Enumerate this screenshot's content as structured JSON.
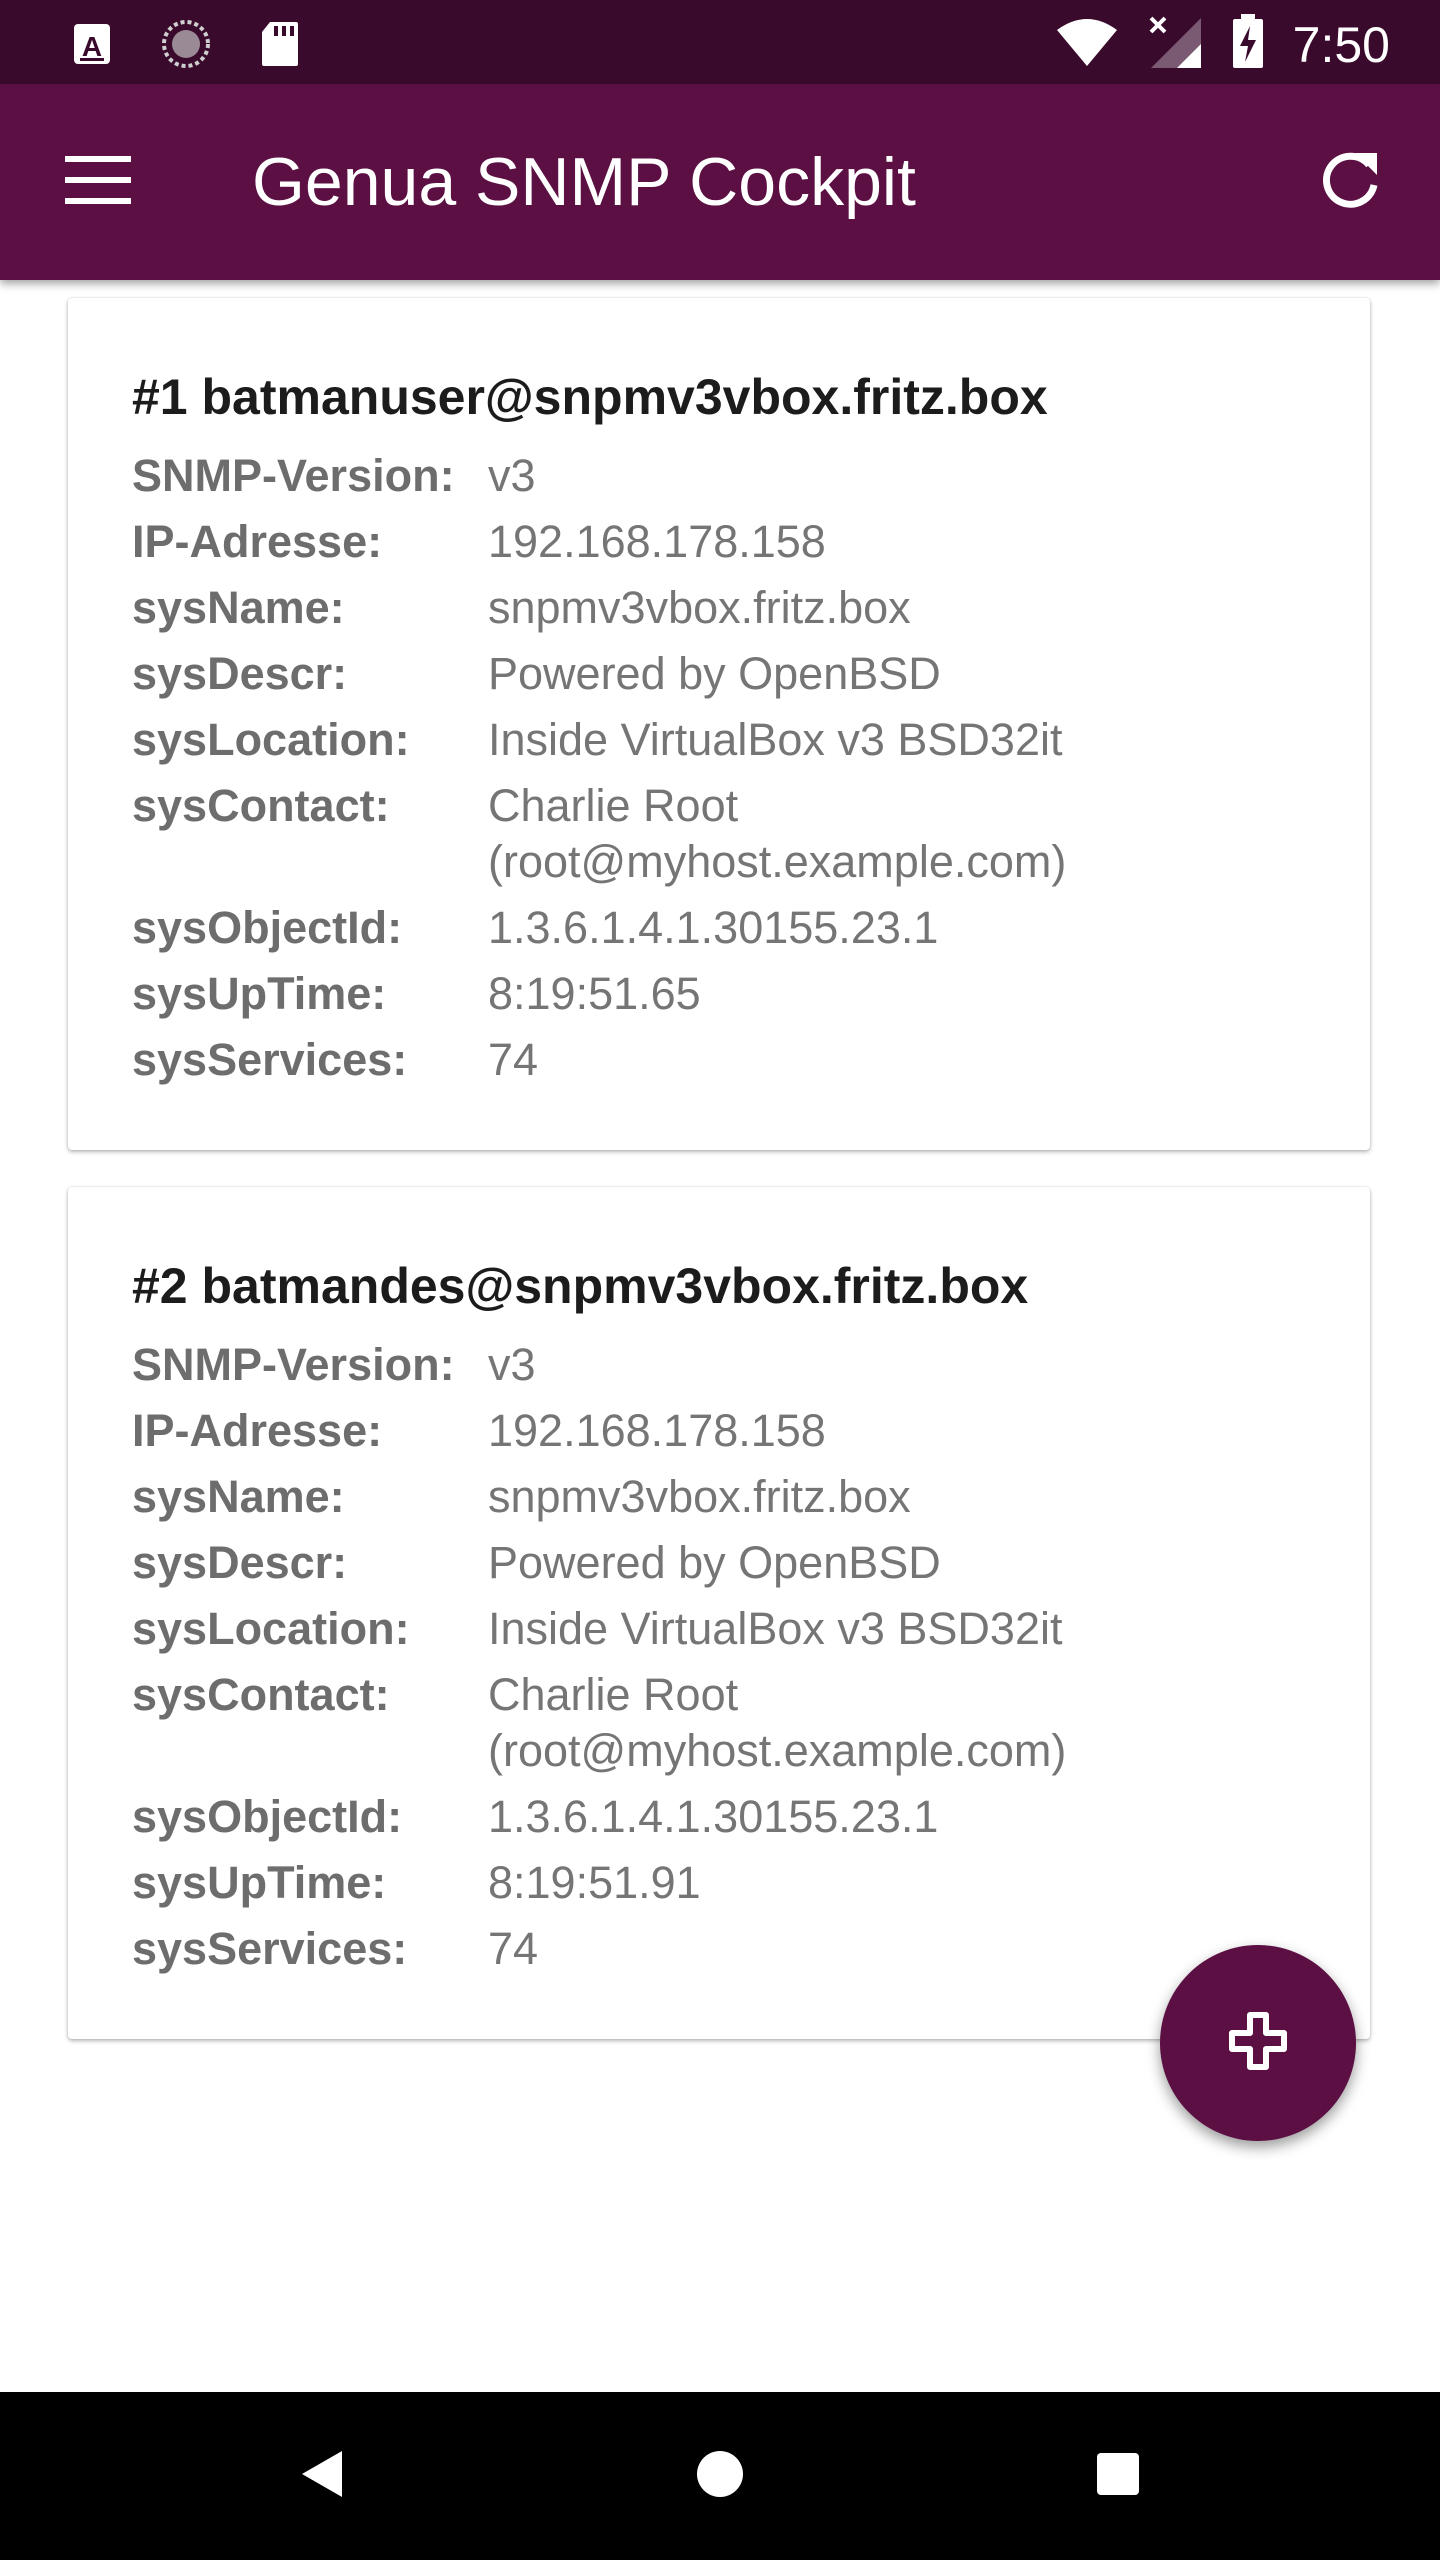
{
  "status_bar": {
    "time": "7:50",
    "icons_left": [
      "a-notification-icon",
      "sync-icon",
      "sd-card-icon"
    ],
    "icons_right": [
      "wifi-icon",
      "cellular-no-signal-icon",
      "battery-charging-icon"
    ]
  },
  "app_bar": {
    "title": "Genua SNMP Cockpit",
    "menu_icon": "hamburger-menu-icon",
    "refresh_icon": "refresh-icon",
    "color": "#5b0f43"
  },
  "devices": [
    {
      "title": "#1 batmanuser@snpmv3vbox.fritz.box",
      "rows": [
        {
          "label": "SNMP-Version:",
          "value": "v3"
        },
        {
          "label": "IP-Adresse:",
          "value": "192.168.178.158"
        },
        {
          "label": "sysName:",
          "value": "snpmv3vbox.fritz.box"
        },
        {
          "label": "sysDescr:",
          "value": "Powered by OpenBSD"
        },
        {
          "label": "sysLocation:",
          "value": "Inside VirtualBox v3 BSD32it"
        },
        {
          "label": "sysContact:",
          "value": "Charlie Root\n(root@myhost.example.com)"
        },
        {
          "label": "sysObjectId:",
          "value": "1.3.6.1.4.1.30155.23.1"
        },
        {
          "label": "sysUpTime:",
          "value": "8:19:51.65"
        },
        {
          "label": "sysServices:",
          "value": "74"
        }
      ]
    },
    {
      "title": "#2 batmandes@snpmv3vbox.fritz.box",
      "rows": [
        {
          "label": "SNMP-Version:",
          "value": "v3"
        },
        {
          "label": "IP-Adresse:",
          "value": "192.168.178.158"
        },
        {
          "label": "sysName:",
          "value": "snpmv3vbox.fritz.box"
        },
        {
          "label": "sysDescr:",
          "value": "Powered by OpenBSD"
        },
        {
          "label": "sysLocation:",
          "value": "Inside VirtualBox v3 BSD32it"
        },
        {
          "label": "sysContact:",
          "value": "Charlie Root\n(root@myhost.example.com)"
        },
        {
          "label": "sysObjectId:",
          "value": "1.3.6.1.4.1.30155.23.1"
        },
        {
          "label": "sysUpTime:",
          "value": "8:19:51.91"
        },
        {
          "label": "sysServices:",
          "value": "74"
        }
      ]
    }
  ],
  "fab": {
    "icon": "plus-icon",
    "color": "#5b0f43"
  },
  "nav_bar": {
    "icons": [
      "back-icon",
      "home-icon",
      "recents-icon"
    ]
  }
}
